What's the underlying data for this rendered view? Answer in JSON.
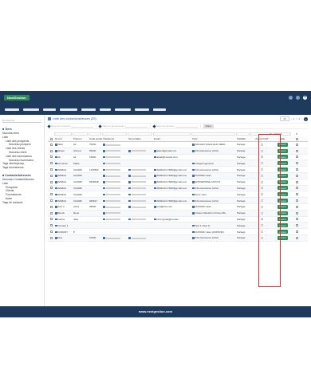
{
  "app": {
    "brand": "NextGestion"
  },
  "sidebar": {
    "search_placeholder": "Rechercher",
    "sections": [
      {
        "title": "Tiers",
        "items": [
          {
            "label": "Nouveau tiers",
            "level": 1
          },
          {
            "label": "Liste",
            "level": 1
          },
          {
            "label": "Liste des prospects",
            "level": 2
          },
          {
            "label": "Nouveau prospect",
            "level": 3
          },
          {
            "label": "Liste des clients",
            "level": 2
          },
          {
            "label": "Nouveau client",
            "level": 3
          },
          {
            "label": "Liste des fournisseurs",
            "level": 2
          },
          {
            "label": "Nouveau fournisseur",
            "level": 3
          },
          {
            "label": "Tags clients/prosp.",
            "level": 1
          },
          {
            "label": "Tags fournisseurs",
            "level": 1
          }
        ]
      },
      {
        "title": "Contacts/Adresses",
        "items": [
          {
            "label": "Nouveau Contact/Adresse",
            "level": 1
          },
          {
            "label": "Liste",
            "level": 1
          },
          {
            "label": "Prospects",
            "level": 2
          },
          {
            "label": "Clients",
            "level": 2
          },
          {
            "label": "Fournisseurs",
            "level": 2
          },
          {
            "label": "Autre",
            "level": 2
          },
          {
            "label": "Tags de contacts",
            "level": 1
          }
        ]
      }
    ]
  },
  "main": {
    "title": "Liste des contacts/adresses (20)",
    "pager": {
      "per_page": "20",
      "page": "1",
      "total": "2"
    },
    "filters": [
      "Tags de prospects",
      "Tags de fournisseurs",
      "Tags de contacts"
    ],
    "filter_button": "Filtrer",
    "optin_filter_value": "Accord",
    "columns": [
      "Nom ▾",
      "Prénom",
      "Code postal",
      "Téléphone",
      "Tel portable",
      "Email",
      "Tiers",
      "Visibilité",
      "Accord OUT",
      "Etat"
    ],
    "rows": [
      {
        "nom": "Marc",
        "prenom": "Ali",
        "cp": "75000",
        "tel": true,
        "port": false,
        "email": "",
        "tiers": "ARCLEO (DHALIAHC MEDI...",
        "vis": "Partagé",
        "optin": false,
        "etat": "Ouvert"
      },
      {
        "nom": "Alaoui",
        "prenom": "Ahmed",
        "cp": "65000",
        "tel": true,
        "port": true,
        "email": "alaoui@gmail.com",
        "tiers": "AXA Assurance (AXA)",
        "vis": "Partagé",
        "optin": false,
        "etat": "Ouvert"
      },
      {
        "nom": "Ali",
        "prenom": "Ali",
        "cp": "15000",
        "tel": true,
        "port": false,
        "email": "ali\\ali@contact.com",
        "tiers": "",
        "vis": "Partagé",
        "optin": true,
        "etat": "Ouvert"
      },
      {
        "nom": "Annoncio",
        "prenom": "Pablo",
        "cp": "",
        "tel": true,
        "port": false,
        "email": "",
        "tiers": "Ortega Ingeniería",
        "vis": "Partagé",
        "optin": false,
        "etat": "Ouvert"
      },
      {
        "nom": "ARMAA",
        "prenom": "CHARIF",
        "cp": "1147800",
        "tel": true,
        "port": true,
        "email": "ARMAAO.NWR@gmail.com",
        "tiers": "AXA Assurance (AXA)",
        "vis": "Partagé",
        "optin": false,
        "etat": "Ouvert"
      },
      {
        "nom": "ARMAA",
        "prenom": "CHARIF",
        "cp": "",
        "tel": true,
        "port": true,
        "email": "ARMAAO.NWR@gmail.com",
        "tiers": "DUPOND Jean",
        "vis": "Partagé",
        "optin": false,
        "etat": "Ouvert"
      },
      {
        "nom": "ARMAA",
        "prenom": "CHARIF",
        "cp": "9546648",
        "tel": true,
        "port": true,
        "email": "ARMAAO.NWR@gmail.com",
        "tiers": "ENTREPRISE CATCOJ",
        "vis": "Partagé",
        "optin": false,
        "etat": "Ouvert"
      },
      {
        "nom": "ARMAA",
        "prenom": "CHARIF",
        "cp": "",
        "tel": true,
        "port": true,
        "email": "ARMAAO.NWR@gmail.com",
        "tiers": "AXA Assurance (AXA)",
        "vis": "Partagé",
        "optin": false,
        "etat": "Ouvert"
      },
      {
        "nom": "ARMAA",
        "prenom": "CHARIF",
        "cp": "",
        "tel": true,
        "port": true,
        "email": "",
        "tiers": "Autre Tiers",
        "vis": "Partagé",
        "optin": false,
        "etat": "Ouvert"
      },
      {
        "nom": "ARMAA",
        "prenom": "CHARIF",
        "cp": "966647",
        "tel": true,
        "port": true,
        "email": "ARMAAO.NWR@gmail.com",
        "tiers": "AXA Assurance (AXA)",
        "vis": "Partagé",
        "optin": false,
        "etat": "Ouvert"
      },
      {
        "nom": "Aziz 2",
        "prenom": "aziz2",
        "cp": "35000",
        "tel": true,
        "port": true,
        "email": "toto@toto.com",
        "tiers": "DUPOND Jean",
        "vis": "Partagé",
        "optin": false,
        "etat": "Ouvert"
      },
      {
        "nom": "Bouck",
        "prenom": "René",
        "cp": "",
        "tel": true,
        "port": false,
        "email": "",
        "tiers": "Orrieso Ménkitro (Orreso Mé...",
        "vis": "Partagé",
        "optin": false,
        "etat": "Ouvert"
      },
      {
        "nom": "Carlos",
        "prenom": "Jack",
        "cp": "",
        "tel": true,
        "port": true,
        "email": "rdvCrypted@Contac...",
        "tiers": "",
        "vis": "Partagé",
        "optin": true,
        "etat": "Ouvert"
      },
      {
        "nom": "Contact 1",
        "prenom": "",
        "cp": "",
        "tel": false,
        "port": false,
        "email": "",
        "tiers": "Test 1 (Test 1)",
        "vis": "Partagé",
        "optin": false,
        "etat": "Ouvert"
      },
      {
        "nom": "DURANT",
        "prenom": "P",
        "cp": "",
        "tel": false,
        "port": false,
        "email": "",
        "tiers": "DUPOND Jean (DUPOND)",
        "vis": "Partagé",
        "optin": false,
        "etat": "Ouvert"
      },
      {
        "nom": "fans",
        "prenom": "",
        "cp": "21600",
        "tel": true,
        "port": true,
        "email": "",
        "tiers": "AXA Assurance (AXA)",
        "vis": "Partagé",
        "optin": false,
        "etat": "Ouvert"
      }
    ]
  },
  "footer": {
    "text": "www.nextgestion.com"
  },
  "colors": {
    "nav": "#1e3a5c",
    "accent": "#2e8b57",
    "highlight": "#d32f2f"
  }
}
